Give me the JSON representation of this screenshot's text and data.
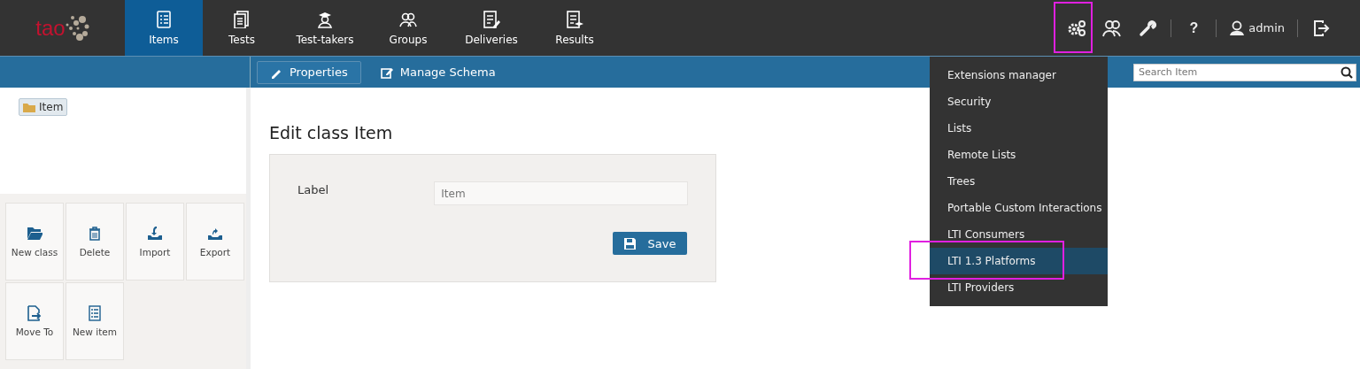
{
  "header": {
    "logo": "tao",
    "tabs": [
      {
        "label": "Items",
        "selected": true
      },
      {
        "label": "Tests",
        "selected": false
      },
      {
        "label": "Test-takers",
        "selected": false
      },
      {
        "label": "Groups",
        "selected": false
      },
      {
        "label": "Deliveries",
        "selected": false
      },
      {
        "label": "Results",
        "selected": false
      }
    ],
    "settings": {
      "highlighted": true
    },
    "help": "?",
    "user": "admin"
  },
  "subnav": {
    "actions": [
      {
        "label": "Properties",
        "selected": true
      },
      {
        "label": "Manage Schema",
        "selected": false
      }
    ],
    "search": {
      "placeholder": "Search Item"
    }
  },
  "tree": {
    "root": {
      "label": "Item",
      "selected": true
    }
  },
  "actions": [
    "New class",
    "Delete",
    "Import",
    "Export",
    "Move To",
    "New item"
  ],
  "form": {
    "title": "Edit class Item",
    "field_label": "Label",
    "field_placeholder": "Item",
    "save": "Save"
  },
  "settings_menu": [
    {
      "label": "Extensions manager",
      "selected": false,
      "highlighted": false
    },
    {
      "label": "Security",
      "selected": false,
      "highlighted": false
    },
    {
      "label": "Lists",
      "selected": false,
      "highlighted": false
    },
    {
      "label": "Remote Lists",
      "selected": false,
      "highlighted": false
    },
    {
      "label": "Trees",
      "selected": false,
      "highlighted": false
    },
    {
      "label": "Portable Custom Interactions",
      "selected": false,
      "highlighted": false
    },
    {
      "label": "LTI Consumers",
      "selected": false,
      "highlighted": false
    },
    {
      "label": "LTI 1.3 Platforms",
      "selected": true,
      "highlighted": true
    },
    {
      "label": "LTI Providers",
      "selected": false,
      "highlighted": false
    }
  ]
}
